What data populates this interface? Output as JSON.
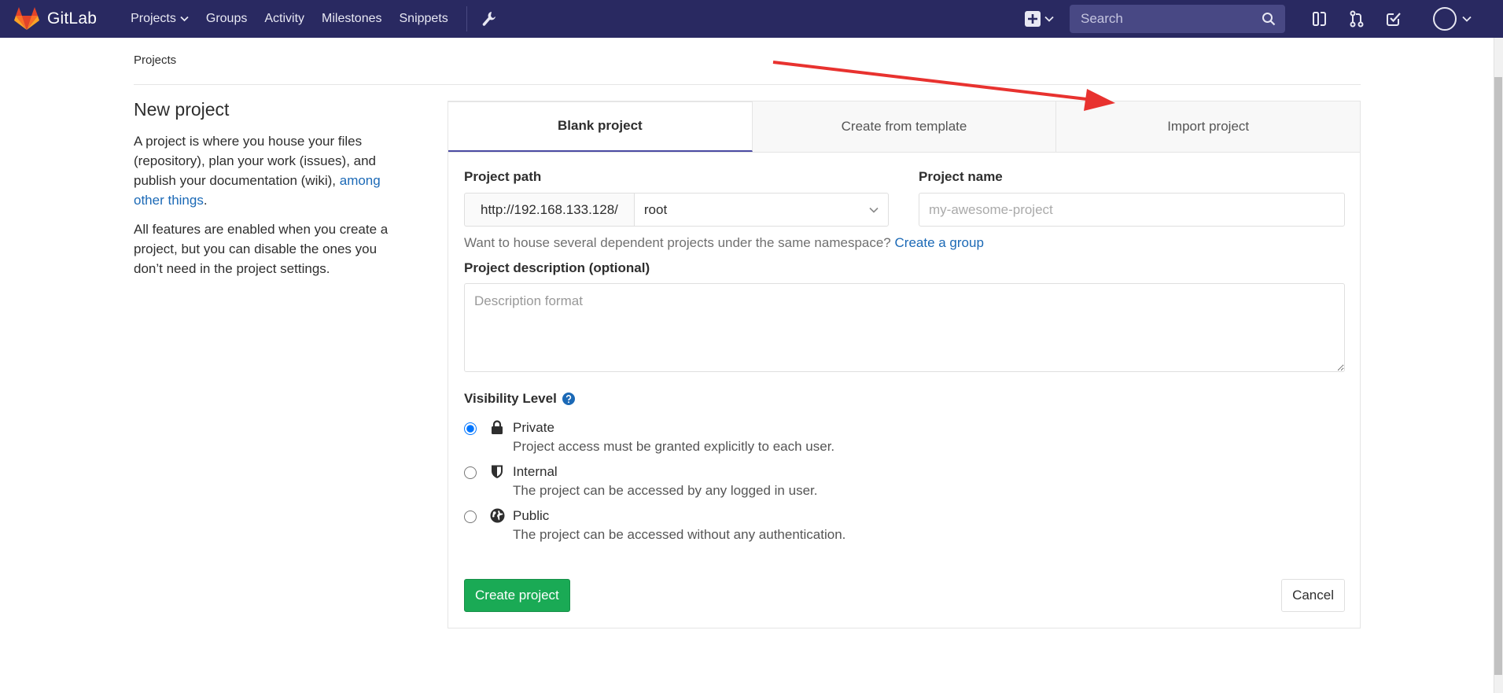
{
  "navbar": {
    "brand": "GitLab",
    "links": [
      "Projects",
      "Groups",
      "Activity",
      "Milestones",
      "Snippets"
    ],
    "search_placeholder": "Search"
  },
  "breadcrumb": "Projects",
  "sidebar": {
    "title": "New project",
    "para1_text": "A project is where you house your files (repository), plan your work (issues), and publish your documentation (wiki), ",
    "para1_link": "among other things",
    "para1_end": ".",
    "para2": "All features are enabled when you create a project, but you can disable the ones you don’t need in the project settings."
  },
  "tabs": [
    "Blank project",
    "Create from template",
    "Import project"
  ],
  "form": {
    "path_label": "Project path",
    "path_prefix": "http://192.168.133.128/",
    "namespace": "root",
    "name_label": "Project name",
    "name_placeholder": "my-awesome-project",
    "help_text": "Want to house several dependent projects under the same namespace? ",
    "help_link": "Create a group",
    "desc_label": "Project description (optional)",
    "desc_placeholder": "Description format",
    "visibility_label": "Visibility Level",
    "visibility": [
      {
        "name": "Private",
        "desc": "Project access must be granted explicitly to each user.",
        "checked": true,
        "icon": "lock-icon"
      },
      {
        "name": "Internal",
        "desc": "The project can be accessed by any logged in user.",
        "checked": false,
        "icon": "shield-icon"
      },
      {
        "name": "Public",
        "desc": "The project can be accessed without any authentication.",
        "checked": false,
        "icon": "globe-icon"
      }
    ],
    "create_button": "Create project",
    "cancel_button": "Cancel"
  },
  "colors": {
    "navbar": "#292961",
    "accent_link": "#1b69b6",
    "create_button": "#1aaa55",
    "annotation_arrow": "#e8322f"
  }
}
